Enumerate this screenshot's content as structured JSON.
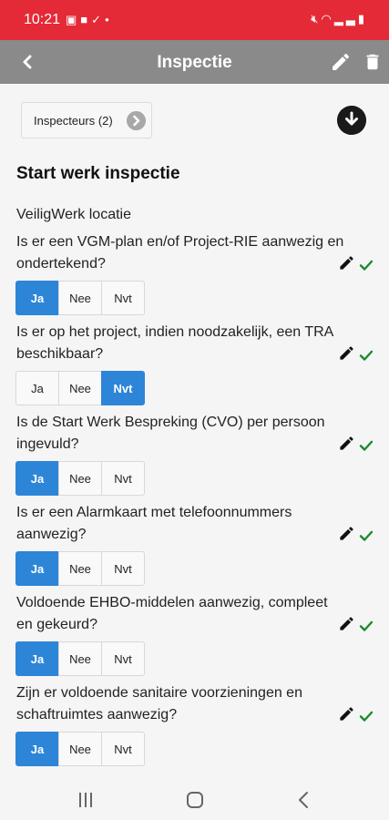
{
  "status_bar": {
    "time": "10:21",
    "left_icons": [
      "gallery-icon",
      "teams-icon",
      "checklist-icon",
      "dot-icon"
    ],
    "right_icons": [
      "mute-icon",
      "wifi-icon",
      "signal-icon",
      "battery-icon"
    ]
  },
  "header": {
    "title": "Inspectie",
    "back_icon": "arrow-left-icon",
    "edit_icon": "pencil-icon",
    "delete_icon": "trash-icon",
    "bar_color": "#8a8a8a"
  },
  "inspecteurs": {
    "label": "Inspecteurs (2)"
  },
  "section": {
    "title": "Start werk inspectie",
    "location": "VeiligWerk locatie"
  },
  "options": [
    "Ja",
    "Nee",
    "Nvt"
  ],
  "accent_color": "#2d85d7",
  "questions": [
    {
      "text": "Is er een VGM-plan en/of Project-RIE aanwezig en ondertekend?",
      "selected": "Ja"
    },
    {
      "text": "Is er op het project, indien noodzakelijk, een TRA beschikbaar?",
      "selected": "Nvt"
    },
    {
      "text": "Is de Start Werk Bespreking (CVO) per persoon ingevuld?",
      "selected": "Ja"
    },
    {
      "text": "Is er een Alarmkaart met telefoonnummers aanwezig?",
      "selected": "Ja"
    },
    {
      "text": "Voldoende EHBO-middelen aanwezig, compleet en gekeurd?",
      "selected": "Ja"
    },
    {
      "text": "Zijn er voldoende sanitaire voorzieningen en schaftruimtes aanwezig?",
      "selected": "Ja"
    }
  ]
}
